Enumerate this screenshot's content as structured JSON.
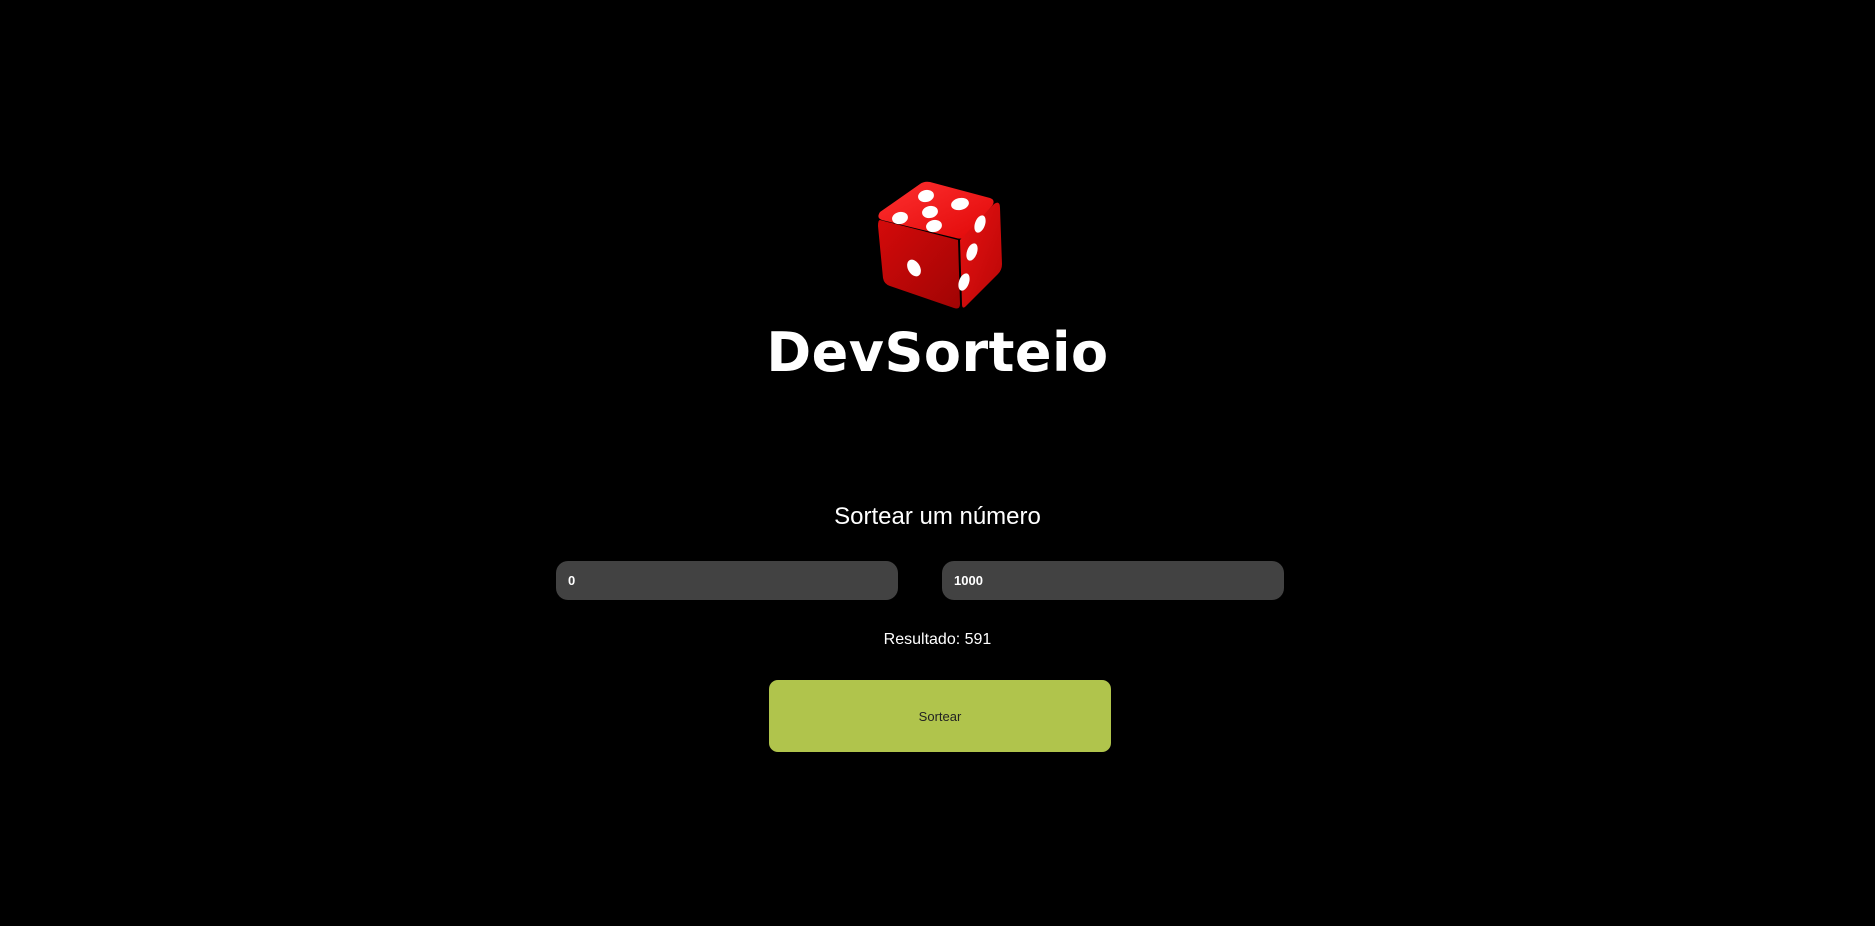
{
  "header": {
    "logo_icon": "red-dice-icon",
    "title": "DevSorteio"
  },
  "main": {
    "section_title": "Sortear um número",
    "min_value": "0",
    "max_value": "1000",
    "result_label": "Resultado: 591",
    "draw_button_label": "Sortear"
  },
  "colors": {
    "background": "#000000",
    "input_background": "#424242",
    "button_accent": "#b0c44c",
    "dice_red": "#e01010"
  }
}
